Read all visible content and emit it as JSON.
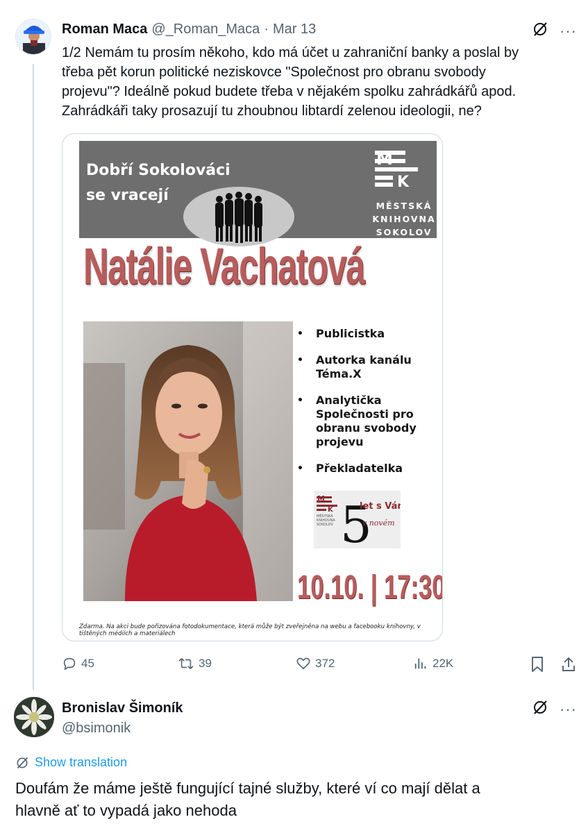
{
  "tweet": {
    "author_name": "Roman Maca",
    "handle": "@_Roman_Maca",
    "separator": "·",
    "date": "Mar 13",
    "text": "1/2 Nemám tu prosím někoho, kdo má účet u zahraniční banky a poslal by\ntřeba pět korun politické neziskovce \"Společnost pro obranu svobody\nprojevu\"? Ideálně pokud budete třeba v nějakém spolku zahrádkářů apod.\nZahrádkáři taky prosazují tu zhoubnou libtardí zelenou ideologii, ne?",
    "more_label": "···"
  },
  "poster": {
    "header_line1": "Dobří Sokolováci",
    "header_line2": "se vracejí",
    "logo_top": "M",
    "logo_bottom": "K",
    "library_name": "MĚSTSKÁ\nKNIHOVNA\nSOKOLOV",
    "speaker": "Natálie Vachatová",
    "bullets": [
      "Publicistka",
      "Autorka kanálu\nTéma.X",
      "Analytička\nSpolečnosti pro\nobranu svobody\nprojevu",
      "Překladatelka"
    ],
    "badge_number": "5",
    "badge_text": "let s Vámi",
    "badge_sub": "v novém",
    "badge_library": "MĚSTSKÁ\nKNIHOVNA\nSOKOLOV",
    "date_time": "10.10. | 17:30",
    "fine_print": "Zdarma. Na akci bude pořizována fotodokumentace, která může být zveřejněna na webu a facebooku knihovny, v tištěných médiích a materiálech"
  },
  "actions": {
    "replies": "45",
    "retweets": "39",
    "likes": "372",
    "views": "22K"
  },
  "reply": {
    "author_name": "Bronislav Šimoník",
    "handle": "@bsimonik",
    "translation_label": "Show translation",
    "text": "Doufám že máme ještě fungující tajné služby, které ví co mají dělat a\nhlavně ať to vypadá jako nehoda",
    "more_label": "···"
  },
  "colors": {
    "secondary_text": "#536471",
    "link": "#1d9bf0",
    "poster_gray": "#6e6e6e",
    "poster_accent": "#b85c5c"
  },
  "icons": [
    "grok-icon",
    "reply-icon",
    "retweet-icon",
    "heart-icon",
    "views-icon",
    "bookmark-icon",
    "share-icon",
    "translate-icon"
  ]
}
